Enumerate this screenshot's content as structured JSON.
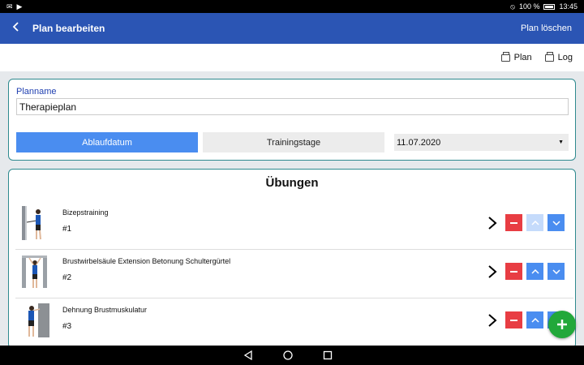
{
  "status_bar": {
    "battery": "100 %",
    "time": "13:45"
  },
  "app_bar": {
    "title": "Plan bearbeiten",
    "action": "Plan löschen"
  },
  "toolbar": {
    "plan_label": "Plan",
    "log_label": "Log"
  },
  "plan": {
    "name_label": "Planname",
    "name_value": "Therapieplan",
    "expiry_button": "Ablaufdatum",
    "training_days_button": "Trainingstage",
    "date_selected": "11.07.2020"
  },
  "exercises": {
    "title": "Übungen",
    "items": [
      {
        "name": "Bizepstraining",
        "number": "#1"
      },
      {
        "name": "Brustwirbelsäule Extension Betonung Schultergürtel",
        "number": "#2"
      },
      {
        "name": "Dehnung Brustmuskulatur",
        "number": "#3"
      }
    ]
  },
  "colors": {
    "app_bar": "#2b55b4",
    "accent_blue": "#4a8df0",
    "delete_red": "#e83d43",
    "fab_green": "#22a83a",
    "card_border": "#2f8a8f"
  }
}
